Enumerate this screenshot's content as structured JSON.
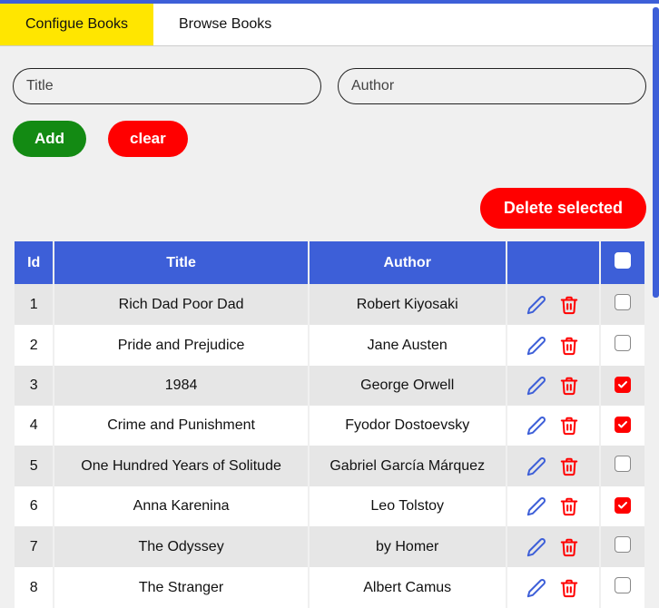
{
  "tabs": {
    "configure": "Configue Books",
    "browse": "Browse Books"
  },
  "form": {
    "title_placeholder": "Title",
    "author_placeholder": "Author",
    "add_label": "Add",
    "clear_label": "clear"
  },
  "delete_selected_label": "Delete selected",
  "table": {
    "headers": {
      "id": "Id",
      "title": "Title",
      "author": "Author"
    },
    "rows": [
      {
        "id": "1",
        "title": "Rich Dad Poor Dad",
        "author": "Robert Kiyosaki",
        "checked": false
      },
      {
        "id": "2",
        "title": "Pride and Prejudice",
        "author": "Jane Austen",
        "checked": false
      },
      {
        "id": "3",
        "title": "1984",
        "author": "George Orwell",
        "checked": true
      },
      {
        "id": "4",
        "title": "Crime and Punishment",
        "author": "Fyodor Dostoevsky",
        "checked": true
      },
      {
        "id": "5",
        "title": "One Hundred Years of Solitude",
        "author": "Gabriel García Márquez",
        "checked": false
      },
      {
        "id": "6",
        "title": "Anna Karenina",
        "author": "Leo Tolstoy",
        "checked": true
      },
      {
        "id": "7",
        "title": "The Odyssey",
        "author": "by Homer",
        "checked": false
      },
      {
        "id": "8",
        "title": "The Stranger",
        "author": "Albert Camus",
        "checked": false
      }
    ]
  },
  "colors": {
    "primary": "#3d5fd8",
    "accent_yellow": "#ffe600",
    "danger": "#ff0000",
    "success": "#138a13"
  }
}
